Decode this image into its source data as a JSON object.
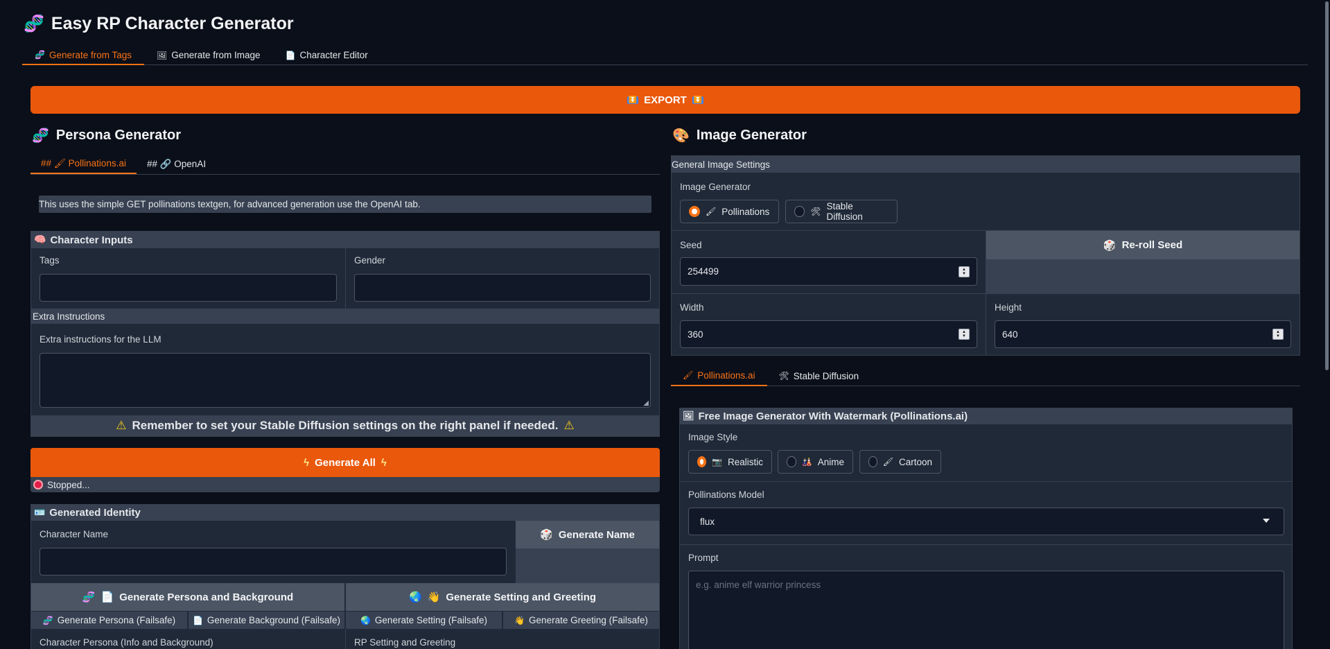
{
  "app": {
    "title": "Easy RP Character Generator",
    "icon": "dna-icon"
  },
  "main_tabs": [
    {
      "label": "Generate from Tags",
      "icon": "dna-icon",
      "active": true
    },
    {
      "label": "Generate from Image",
      "icon": "picture-icon",
      "active": false
    },
    {
      "label": "Character Editor",
      "icon": "page-icon",
      "active": false
    }
  ],
  "export": {
    "label": "EXPORT",
    "icon": "double-down-arrow-icon"
  },
  "persona": {
    "title": "Persona Generator",
    "tabs": [
      {
        "label": "## 🖌 Pollinations.ai",
        "active": true
      },
      {
        "label": "## 🔗 OpenAI",
        "active": false
      }
    ],
    "info_text": "This uses the simple GET pollinations textgen, for advanced generation use the OpenAI tab.",
    "character_inputs": {
      "title": "Character Inputs",
      "tags_label": "Tags",
      "tags_value": "",
      "gender_label": "Gender",
      "gender_value": ""
    },
    "extra": {
      "section_label": "Extra Instructions",
      "field_label": "Extra instructions for the LLM",
      "value": ""
    },
    "warning": "Remember to set your Stable Diffusion settings on the right panel if needed.",
    "generate_all": "Generate All",
    "status": "Stopped...",
    "identity": {
      "title": "Generated Identity",
      "name_label": "Character Name",
      "name_value": "",
      "generate_name": "Generate Name",
      "persona_bg_button": "Generate Persona and Background",
      "setting_greeting_button": "Generate Setting and Greeting",
      "failsafe_buttons": [
        "Generate Persona (Failsafe)",
        "Generate Background (Failsafe)",
        "Generate Setting (Failsafe)",
        "Generate Greeting (Failsafe)"
      ],
      "persona_label": "Character Persona (Info and Background)",
      "setting_label": "RP Setting and Greeting"
    }
  },
  "image": {
    "title": "Image Generator",
    "general_settings": "General Image Settings",
    "generator_label": "Image Generator",
    "generator_options": [
      {
        "label": "Pollinations",
        "selected": true
      },
      {
        "label": "Stable Diffusion",
        "selected": false
      }
    ],
    "seed_label": "Seed",
    "seed_value": "254499",
    "reroll_label": "Re-roll Seed",
    "width_label": "Width",
    "width_value": "360",
    "height_label": "Height",
    "height_value": "640",
    "sub_tabs": [
      {
        "label": "Pollinations.ai",
        "active": true
      },
      {
        "label": "Stable Diffusion",
        "active": false
      }
    ],
    "free_gen_title": "Free Image Generator With Watermark (Pollinations.ai)",
    "style_label": "Image Style",
    "style_options": [
      {
        "label": "Realistic",
        "selected": true
      },
      {
        "label": "Anime",
        "selected": false
      },
      {
        "label": "Cartoon",
        "selected": false
      }
    ],
    "model_label": "Pollinations Model",
    "model_value": "flux",
    "prompt_label": "Prompt",
    "prompt_placeholder": "e.g. anime elf warrior princess"
  },
  "colors": {
    "accent": "#ea580c",
    "accent_text": "#f97316",
    "background": "#0b0f19",
    "panel": "#1f2937"
  }
}
